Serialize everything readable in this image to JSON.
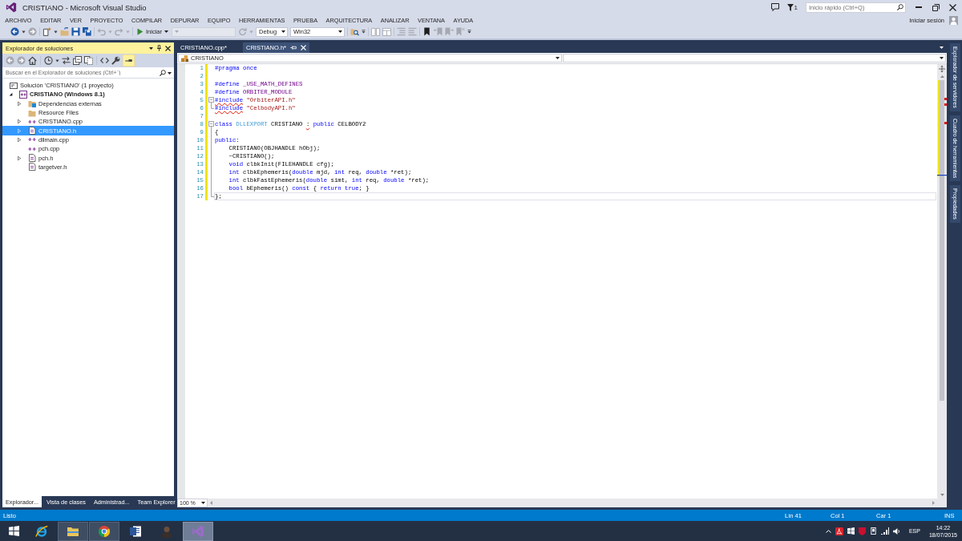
{
  "window": {
    "title": "CRISTIANO - Microsoft Visual Studio",
    "notification_count": "1",
    "quick_launch": {
      "placeholder": "Inicio rápido (Ctrl+Q)"
    }
  },
  "menu": [
    "ARCHIVO",
    "EDITAR",
    "VER",
    "PROYECTO",
    "COMPILAR",
    "DEPURAR",
    "EQUIPO",
    "HERRAMIENTAS",
    "PRUEBA",
    "ARQUITECTURA",
    "ANALIZAR",
    "VENTANA",
    "AYUDA"
  ],
  "account": {
    "sign_in": "Iniciar sesión"
  },
  "toolbar": [
    [
      {
        "kind": "back",
        "disabled": false
      },
      {
        "kind": "caret",
        "disabled": false
      },
      {
        "kind": "forward",
        "disabled": true
      }
    ],
    [
      {
        "kind": "new",
        "disabled": false
      },
      {
        "kind": "caret",
        "disabled": false
      },
      {
        "kind": "open",
        "disabled": false
      },
      {
        "kind": "save",
        "disabled": false
      },
      {
        "kind": "saveall",
        "disabled": false
      }
    ],
    [
      {
        "kind": "undo",
        "disabled": true
      },
      {
        "kind": "caret",
        "disabled": true
      },
      {
        "kind": "redo",
        "disabled": true
      },
      {
        "kind": "caret",
        "disabled": true
      }
    ],
    [
      {
        "kind": "start",
        "label": "Iniciar",
        "disabled": false
      },
      {
        "kind": "combo",
        "disabled": true
      },
      {
        "kind": "refresh",
        "disabled": true
      },
      {
        "kind": "caret",
        "disabled": true
      },
      {
        "kind": "combo",
        "value": "Debug",
        "disabled": false
      },
      {
        "kind": "combo",
        "value": "Win32",
        "disabled": false
      }
    ],
    [
      {
        "kind": "find",
        "disabled": false
      },
      {
        "kind": "overflow",
        "disabled": false
      }
    ],
    [
      {
        "kind": "outdent",
        "disabled": true
      },
      {
        "kind": "indent",
        "disabled": true
      }
    ],
    [
      {
        "kind": "comment",
        "disabled": true
      },
      {
        "kind": "uncomment",
        "disabled": true
      }
    ],
    [
      {
        "kind": "bookmark",
        "disabled": false
      },
      {
        "kind": "prevmark",
        "disabled": true
      },
      {
        "kind": "nextmark",
        "disabled": true
      },
      {
        "kind": "clearmark",
        "disabled": true
      },
      {
        "kind": "overflow",
        "disabled": false
      }
    ]
  ],
  "solution_explorer": {
    "title": "Explorador de soluciones",
    "toolbar": [
      [
        {
          "kind": "back",
          "disabled": true,
          "on": false
        },
        {
          "kind": "forward",
          "disabled": true,
          "on": false
        },
        {
          "kind": "home",
          "disabled": false,
          "on": false
        }
      ],
      [
        {
          "kind": "history",
          "disabled": false,
          "on": false
        },
        {
          "kind": "caret",
          "disabled": false,
          "on": false
        },
        {
          "kind": "sync",
          "disabled": false,
          "on": false
        },
        {
          "kind": "collapse",
          "disabled": false,
          "on": false
        },
        {
          "kind": "files",
          "disabled": false,
          "on": false
        }
      ],
      [
        {
          "kind": "code",
          "disabled": false,
          "on": false
        },
        {
          "kind": "wrench",
          "disabled": false,
          "on": false
        },
        {
          "kind": "preview",
          "disabled": false,
          "on": true
        }
      ]
    ],
    "search": {
      "placeholder": "Buscar en el Explorador de soluciones (Ctrl+´)"
    },
    "tree": [
      {
        "label": "Solución 'CRISTIANO'  (1 proyecto)",
        "kind": "solution",
        "selected": false,
        "children": [
          {
            "label": "CRISTIANO (Windows 8.1)",
            "kind": "project",
            "expanded": true,
            "selected": false,
            "children": [
              {
                "label": "Dependencias externas",
                "kind": "filter",
                "expanded": false,
                "selected": false
              },
              {
                "label": "Resource Files",
                "kind": "folder",
                "selected": false
              },
              {
                "label": "CRISTIANO.cpp",
                "kind": "source",
                "expanded": false,
                "selected": false
              },
              {
                "label": "CRISTIANO.h",
                "kind": "header",
                "expanded": false,
                "selected": true
              },
              {
                "label": "dllmain.cpp",
                "kind": "source",
                "expanded": false,
                "selected": false
              },
              {
                "label": "pch.cpp",
                "kind": "source",
                "selected": false
              },
              {
                "label": "pch.h",
                "kind": "header",
                "expanded": false,
                "selected": false
              },
              {
                "label": "targetver.h",
                "kind": "header",
                "selected": false
              }
            ]
          }
        ]
      }
    ],
    "tabs": [
      {
        "label": "Explorador...",
        "selected": true
      },
      {
        "label": "Vista de clases",
        "selected": false
      },
      {
        "label": "Administrad...",
        "selected": false
      },
      {
        "label": "Team Explorer",
        "selected": false
      }
    ]
  },
  "editor": {
    "tabs": [
      {
        "label": "CRISTIANO.cpp*",
        "selected": false
      },
      {
        "label": "CRISTIANO.h*",
        "selected": true
      }
    ],
    "navigation_bar": {
      "scope": "CRISTIANO"
    },
    "lines": [
      {
        "number": "1",
        "changed": true,
        "kind": "plain",
        "current": false,
        "tokens": [
          {
            "text": "#pragma once",
            "kind": "keyword",
            "squiggle": false
          }
        ]
      },
      {
        "number": "2",
        "changed": true,
        "kind": "plain",
        "current": false
      },
      {
        "number": "3",
        "changed": true,
        "kind": "plain",
        "current": false,
        "tokens": [
          {
            "text": "#define",
            "kind": "keyword",
            "squiggle": false
          },
          {
            "text": " _USE_MATH_DEFINES",
            "kind": "macro",
            "squiggle": false
          }
        ]
      },
      {
        "number": "4",
        "changed": true,
        "kind": "plain",
        "current": false,
        "tokens": [
          {
            "text": "#define",
            "kind": "keyword",
            "squiggle": false
          },
          {
            "text": " ORBITER_MODULE",
            "kind": "macro",
            "squiggle": false
          }
        ]
      },
      {
        "number": "5",
        "changed": true,
        "kind": "start",
        "current": false,
        "tokens": [
          {
            "text": "#include",
            "kind": "keyword",
            "squiggle": true
          },
          {
            "text": " \"OrbiterAPI.h\"",
            "kind": "string",
            "squiggle": false
          }
        ]
      },
      {
        "number": "6",
        "changed": true,
        "kind": "end",
        "current": false,
        "tokens": [
          {
            "text": "#include",
            "kind": "keyword",
            "squiggle": true
          },
          {
            "text": " \"CelbodyAPI.h\"",
            "kind": "string",
            "squiggle": false
          }
        ]
      },
      {
        "number": "7",
        "changed": true,
        "kind": "plain",
        "current": false
      },
      {
        "number": "8",
        "changed": true,
        "kind": "start",
        "current": false,
        "tokens": [
          {
            "text": "class",
            "kind": "keyword",
            "squiggle": false
          },
          {
            "text": " DLLEXPORT",
            "kind": "unresolved",
            "squiggle": false
          },
          {
            "text": " CRISTIANO ",
            "kind": "plain",
            "squiggle": false
          },
          {
            "text": ":",
            "kind": "plain",
            "squiggle": true
          },
          {
            "text": " public",
            "kind": "keyword",
            "squiggle": false
          },
          {
            "text": " CELBODY2",
            "kind": "plain",
            "squiggle": false
          }
        ]
      },
      {
        "number": "9",
        "changed": true,
        "kind": "inside",
        "current": false,
        "tokens": [
          {
            "text": "{",
            "kind": "plain",
            "squiggle": false
          }
        ]
      },
      {
        "number": "10",
        "changed": true,
        "kind": "inside",
        "current": false,
        "tokens": [
          {
            "text": "public:",
            "kind": "keyword",
            "squiggle": false
          }
        ]
      },
      {
        "number": "11",
        "changed": true,
        "kind": "inside",
        "current": false,
        "tokens": [
          {
            "text": "    CRISTIANO(OBJHANDLE hObj);",
            "kind": "plain",
            "squiggle": false
          }
        ]
      },
      {
        "number": "12",
        "changed": true,
        "kind": "inside",
        "current": false,
        "tokens": [
          {
            "text": "    ~CRISTIANO();",
            "kind": "plain",
            "squiggle": false
          }
        ]
      },
      {
        "number": "13",
        "changed": true,
        "kind": "inside",
        "current": false,
        "tokens": [
          {
            "text": "    void",
            "kind": "keyword",
            "squiggle": false
          },
          {
            "text": " clbkInit(FILEHANDLE cfg);",
            "kind": "plain",
            "squiggle": false
          }
        ]
      },
      {
        "number": "14",
        "changed": true,
        "kind": "inside",
        "current": false,
        "tokens": [
          {
            "text": "    int",
            "kind": "keyword",
            "squiggle": false
          },
          {
            "text": " clbkEphemeris(",
            "kind": "plain",
            "squiggle": false
          },
          {
            "text": "double",
            "kind": "keyword",
            "squiggle": false
          },
          {
            "text": " mjd, ",
            "kind": "plain",
            "squiggle": false
          },
          {
            "text": "int",
            "kind": "keyword",
            "squiggle": false
          },
          {
            "text": " req, ",
            "kind": "plain",
            "squiggle": false
          },
          {
            "text": "double",
            "kind": "keyword",
            "squiggle": false
          },
          {
            "text": " *ret);",
            "kind": "plain",
            "squiggle": false
          }
        ]
      },
      {
        "number": "15",
        "changed": true,
        "kind": "inside",
        "current": false,
        "tokens": [
          {
            "text": "    int",
            "kind": "keyword",
            "squiggle": false
          },
          {
            "text": " clbkFastEphemeris(",
            "kind": "plain",
            "squiggle": false
          },
          {
            "text": "double",
            "kind": "keyword",
            "squiggle": false
          },
          {
            "text": " simt, ",
            "kind": "plain",
            "squiggle": false
          },
          {
            "text": "int",
            "kind": "keyword",
            "squiggle": false
          },
          {
            "text": " req, ",
            "kind": "plain",
            "squiggle": false
          },
          {
            "text": "double",
            "kind": "keyword",
            "squiggle": false
          },
          {
            "text": " *ret);",
            "kind": "plain",
            "squiggle": false
          }
        ]
      },
      {
        "number": "16",
        "changed": true,
        "kind": "inside",
        "current": false,
        "tokens": [
          {
            "text": "    bool",
            "kind": "keyword",
            "squiggle": false
          },
          {
            "text": " bEphemeris() ",
            "kind": "plain",
            "squiggle": false
          },
          {
            "text": "const",
            "kind": "keyword",
            "squiggle": false
          },
          {
            "text": " { ",
            "kind": "plain",
            "squiggle": false
          },
          {
            "text": "return",
            "kind": "keyword",
            "squiggle": false
          },
          {
            "text": " true",
            "kind": "keyword",
            "squiggle": false
          },
          {
            "text": "; }",
            "kind": "plain",
            "squiggle": false
          }
        ]
      },
      {
        "number": "17",
        "changed": true,
        "kind": "end",
        "current": true,
        "tokens": [
          {
            "text": "};",
            "kind": "plain",
            "squiggle": false
          }
        ]
      }
    ],
    "zoom": "100 %"
  },
  "side_tabs": [
    "Explorador de servidores",
    "Cuadro de herramientas",
    "Propiedades"
  ],
  "status_bar": {
    "message": "Listo",
    "line": "Lín 41",
    "column": "Col 1",
    "character": "Car 1",
    "mode": "INS"
  },
  "taskbar": {
    "apps": [
      {
        "kind": "browser",
        "running": false,
        "selected": false
      },
      {
        "kind": "folder",
        "running": true,
        "selected": false
      },
      {
        "kind": "circle",
        "running": true,
        "selected": false
      },
      {
        "kind": "document",
        "running": false,
        "selected": false
      },
      {
        "kind": "person",
        "running": false,
        "selected": false
      },
      {
        "kind": "ide",
        "running": true,
        "selected": true
      }
    ],
    "tray": {
      "language": "ESP",
      "time": "14:22",
      "date": "18/07/2015"
    }
  }
}
